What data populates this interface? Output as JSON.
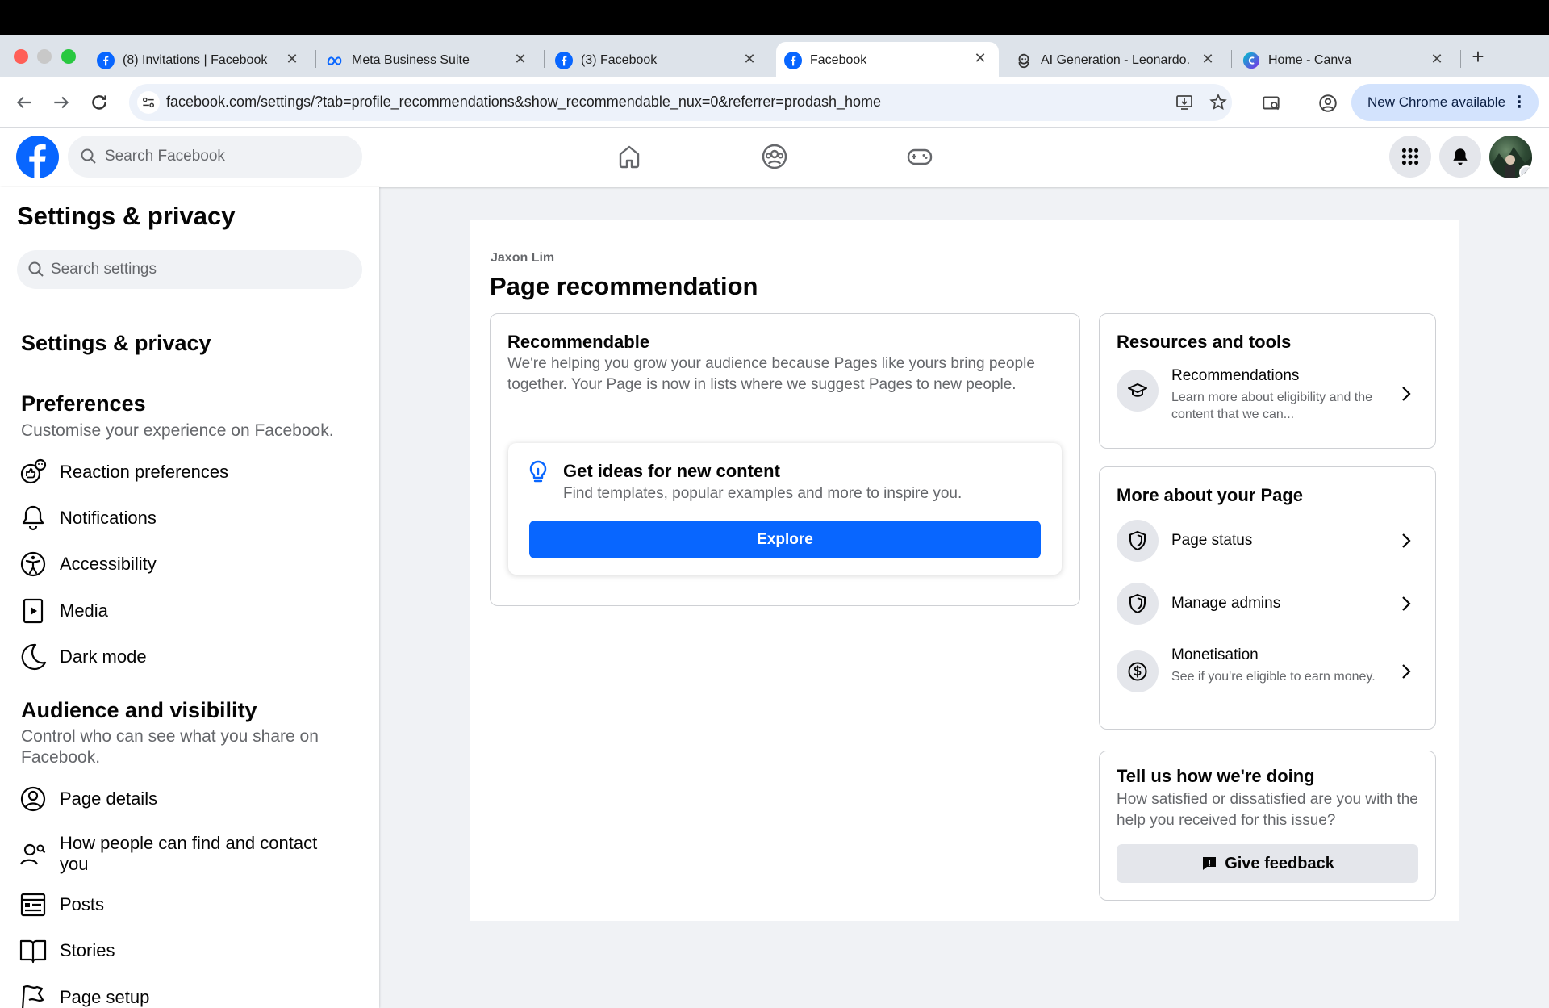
{
  "browser": {
    "tabs": [
      {
        "title": "(8) Invitations | Facebook",
        "icon": "facebook-icon",
        "active": false
      },
      {
        "title": "Meta Business Suite",
        "icon": "meta-icon",
        "active": false
      },
      {
        "title": "(3) Facebook",
        "icon": "facebook-icon",
        "active": false
      },
      {
        "title": "Facebook",
        "icon": "facebook-icon",
        "active": true
      },
      {
        "title": "AI Generation - Leonardo.",
        "icon": "leonardo-icon",
        "active": false
      },
      {
        "title": "Home - Canva",
        "icon": "canva-icon",
        "active": false
      }
    ],
    "close_glyph": "✕",
    "new_tab_glyph": "+",
    "url": "facebook.com/settings/?tab=profile_recommendations&show_recommendable_nux=0&referrer=prodash_home",
    "new_chrome_label": "New Chrome available",
    "menu_glyph": "⋮"
  },
  "fb": {
    "search_placeholder": "Search Facebook",
    "brand_color": "#0866ff"
  },
  "sidebar": {
    "title": "Settings & privacy",
    "search_placeholder": "Search settings",
    "section_title": "Settings & privacy",
    "preferences": {
      "heading": "Preferences",
      "subtitle": "Customise your experience on Facebook.",
      "items": [
        {
          "label": "Reaction preferences",
          "icon": "reaction-icon"
        },
        {
          "label": "Notifications",
          "icon": "bell-icon"
        },
        {
          "label": "Accessibility",
          "icon": "accessibility-icon"
        },
        {
          "label": "Media",
          "icon": "media-icon"
        },
        {
          "label": "Dark mode",
          "icon": "moon-icon"
        }
      ]
    },
    "audience": {
      "heading": "Audience and visibility",
      "subtitle": "Control who can see what you share on Facebook.",
      "items": [
        {
          "label": "Page details",
          "icon": "person-circle-icon"
        },
        {
          "label": "How people can find and contact you",
          "icon": "person-search-icon"
        },
        {
          "label": "Posts",
          "icon": "posts-icon"
        },
        {
          "label": "Stories",
          "icon": "book-icon"
        },
        {
          "label": "Page setup",
          "icon": "flag-icon"
        }
      ]
    }
  },
  "main": {
    "owner": "Jaxon Lim",
    "title": "Page recommendation",
    "recommendable": {
      "title": "Recommendable",
      "description": "We're helping you grow your audience because Pages like yours bring people together. Your Page is now in lists where we suggest Pages to new people."
    },
    "ideas": {
      "title": "Get ideas for new content",
      "description": "Find templates, popular examples and more to inspire you.",
      "button": "Explore"
    },
    "resources": {
      "title": "Resources and tools",
      "items": [
        {
          "label": "Recommendations",
          "sub": "Learn more about eligibility and the content that we can..."
        }
      ]
    },
    "more": {
      "title": "More about your Page",
      "items": [
        {
          "label": "Page status",
          "sub": ""
        },
        {
          "label": "Manage admins",
          "sub": ""
        },
        {
          "label": "Monetisation",
          "sub": "See if you're eligible to earn money."
        }
      ]
    },
    "feedback": {
      "title": "Tell us how we're doing",
      "description": "How satisfied or dissatisfied are you with the help you received for this issue?",
      "button": "Give feedback"
    }
  }
}
